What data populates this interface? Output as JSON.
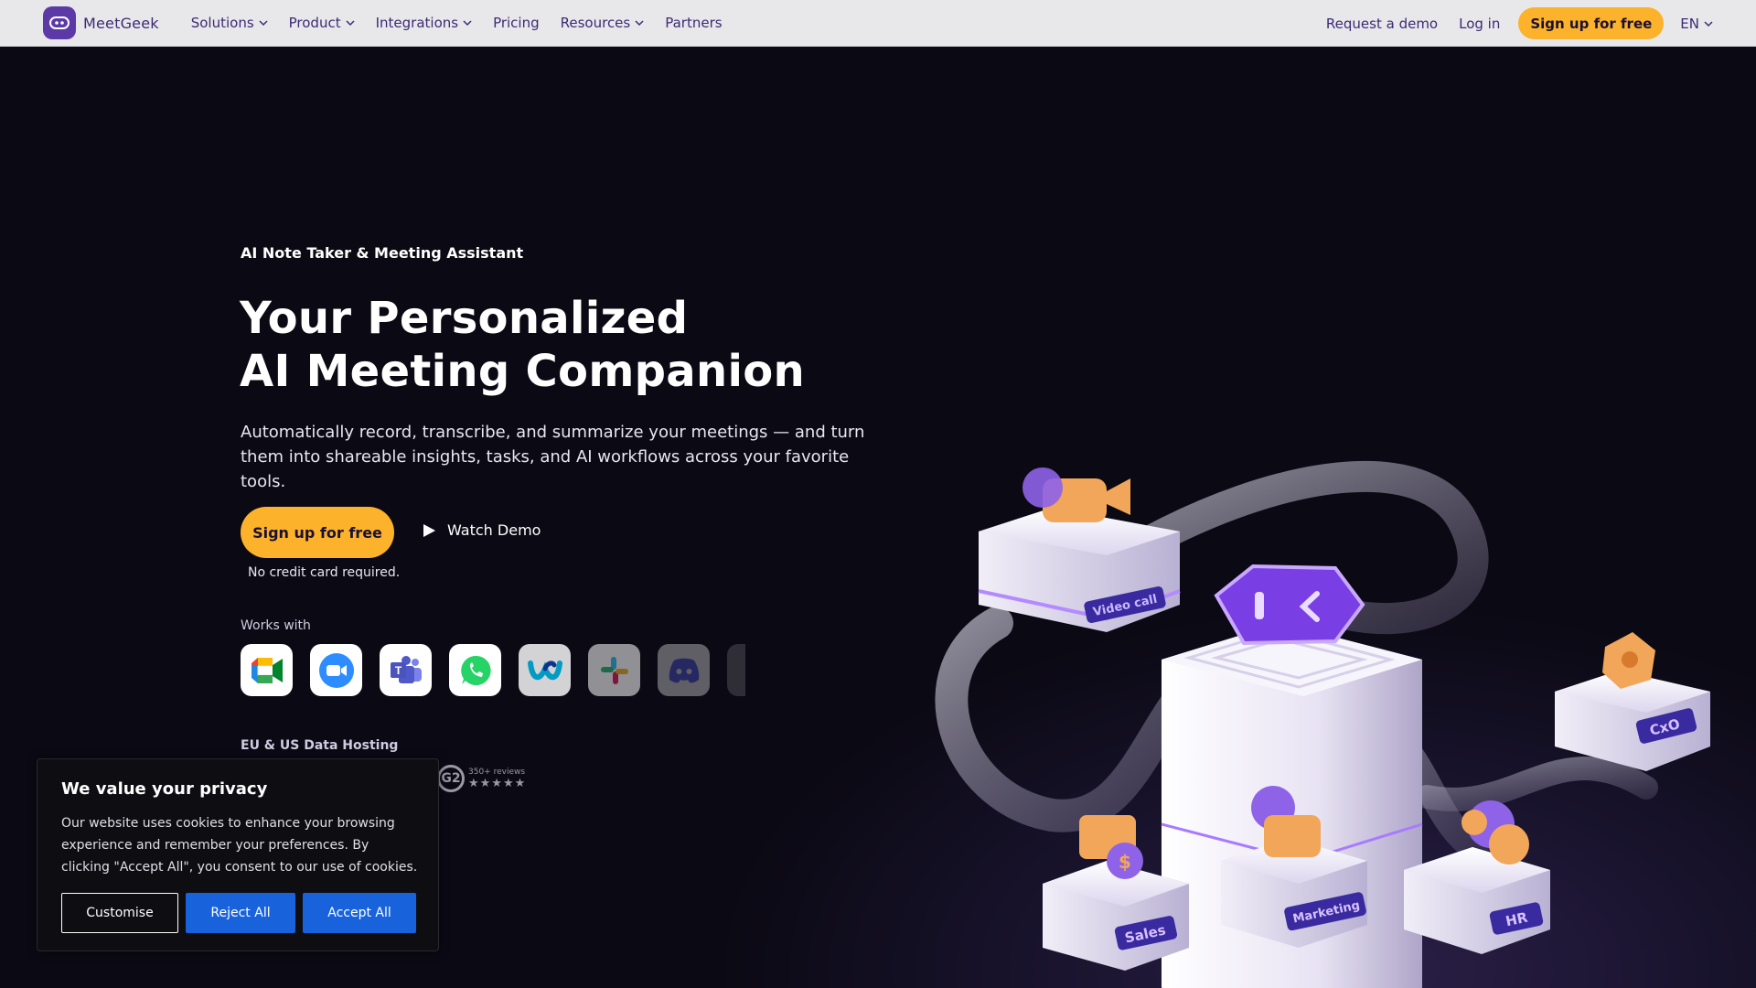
{
  "nav": {
    "brand": "MeetGeek",
    "items": [
      {
        "label": "Solutions",
        "dropdown": true
      },
      {
        "label": "Product",
        "dropdown": true
      },
      {
        "label": "Integrations",
        "dropdown": true
      },
      {
        "label": "Pricing",
        "dropdown": false
      },
      {
        "label": "Resources",
        "dropdown": true
      },
      {
        "label": "Partners",
        "dropdown": false
      }
    ],
    "request_demo": "Request a demo",
    "login": "Log in",
    "signup": "Sign up for free",
    "language": "EN"
  },
  "hero": {
    "eyebrow": "AI Note Taker & Meeting Assistant",
    "headline_line1": "Your Personalized",
    "headline_line2": "AI Meeting Companion",
    "subtitle": "Automatically record, transcribe, and summarize your meetings — and turn them into shareable insights, tasks, and AI workflows across your favorite tools.",
    "cta": "Sign up for free",
    "watch_demo": "Watch Demo",
    "no_card": "No credit card required.",
    "works_with": "Works with",
    "apps": [
      "google-meet-icon",
      "zoom-icon",
      "microsoft-teams-icon",
      "whatsapp-icon",
      "webex-icon",
      "slack-icon",
      "discord-icon"
    ],
    "hosting": "EU & US Data Hosting",
    "reviews_badge": "G2",
    "reviews_count": "350+ reviews",
    "reviews_stars": "★★★★★"
  },
  "illustration": {
    "labels": [
      "Video call",
      "Sales",
      "Marketing",
      "HR",
      "CxO"
    ]
  },
  "cookie": {
    "title": "We value your privacy",
    "text": "Our website uses cookies to enhance your browsing experience and remember your preferences. By clicking \"Accept All\", you consent to our use of cookies.",
    "customise": "Customise",
    "reject": "Reject All",
    "accept": "Accept All"
  },
  "colors": {
    "accent": "#fcb22a",
    "brand": "#5b3aa8",
    "cookie_button": "#1863dc"
  }
}
